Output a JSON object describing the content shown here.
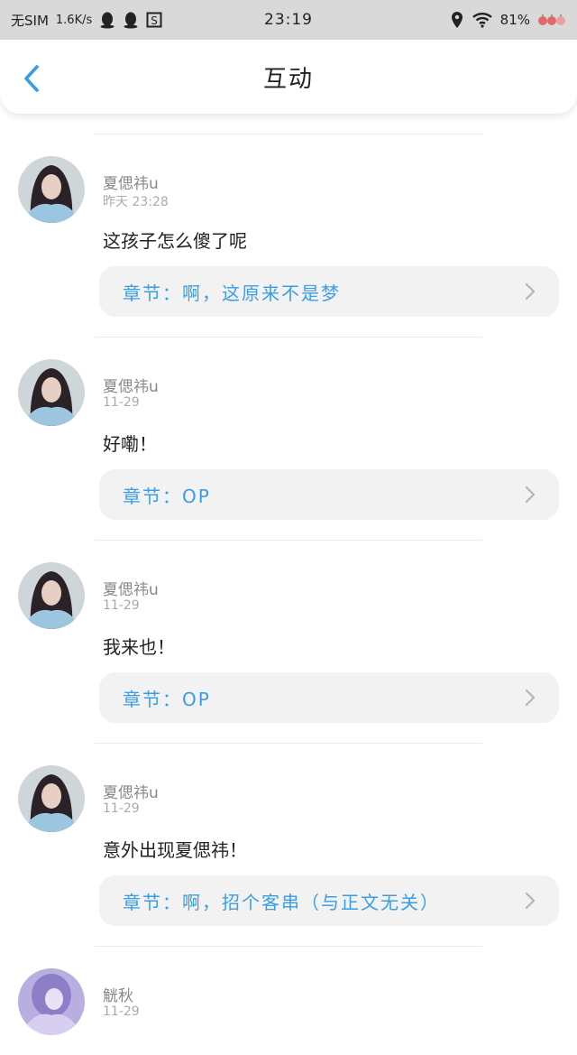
{
  "status_bar": {
    "carrier": "无SIM",
    "speed": "1.6K/s",
    "time": "23:19",
    "battery": "81%"
  },
  "header": {
    "title": "互动"
  },
  "comments": [
    {
      "username": "夏偲祎u",
      "time": "昨天 23:28",
      "content": "这孩子怎么傻了呢",
      "chapter": "章节：啊，这原来不是梦"
    },
    {
      "username": "夏偲祎u",
      "time": "11-29",
      "content": "好嘞！",
      "chapter": "章节：OP"
    },
    {
      "username": "夏偲祎u",
      "time": "11-29",
      "content": "我来也！",
      "chapter": "章节：OP"
    },
    {
      "username": "夏偲祎u",
      "time": "11-29",
      "content": "意外出现夏偲祎！",
      "chapter": "章节：啊，招个客串（与正文无关）"
    },
    {
      "username": "觥秋",
      "time": "11-29",
      "content": "",
      "chapter": ""
    }
  ],
  "colors": {
    "accent": "#3a9ee4",
    "chapter_bg": "#f2f2f2",
    "statusbar_bg": "#d9d9d9"
  }
}
